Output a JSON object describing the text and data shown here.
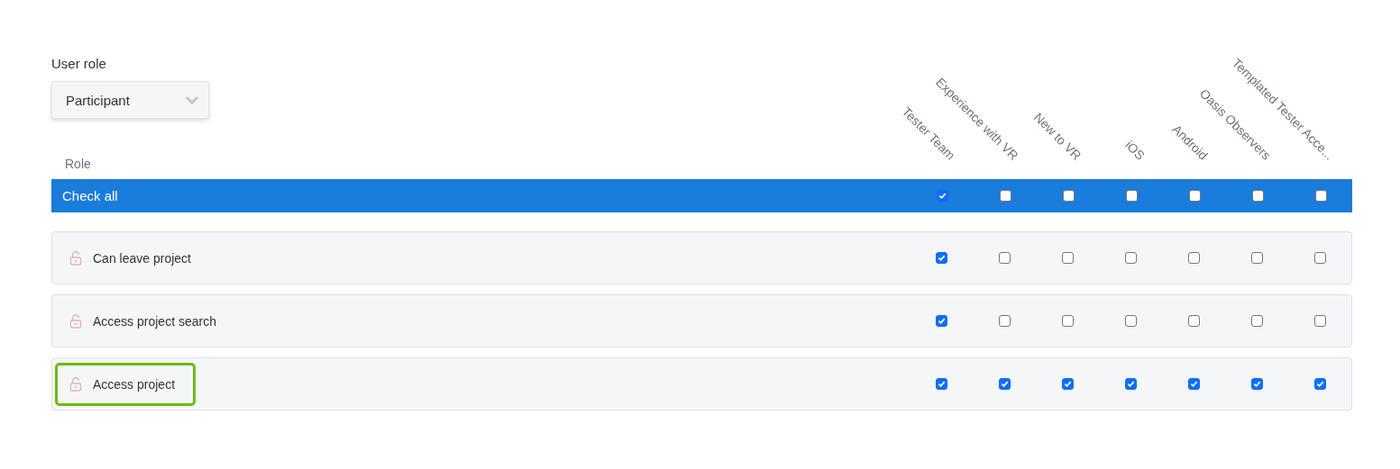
{
  "user_role": {
    "label": "User role",
    "value": "Participant"
  },
  "table": {
    "role_header": "Role",
    "columns": [
      "Tester Team",
      "Experience with VR",
      "New to VR",
      "iOS",
      "Android",
      "Oasis Observers",
      "Templated Tester Acce..."
    ],
    "check_all": {
      "label": "Check all",
      "checked": [
        true,
        false,
        false,
        false,
        false,
        false,
        false
      ]
    },
    "rows": [
      {
        "label": "Can leave project",
        "highlighted": false,
        "checked": [
          true,
          false,
          false,
          false,
          false,
          false,
          false
        ]
      },
      {
        "label": "Access project search",
        "highlighted": false,
        "checked": [
          true,
          false,
          false,
          false,
          false,
          false,
          false
        ]
      },
      {
        "label": "Access project",
        "highlighted": true,
        "checked": [
          true,
          true,
          true,
          true,
          true,
          true,
          true
        ]
      }
    ]
  }
}
